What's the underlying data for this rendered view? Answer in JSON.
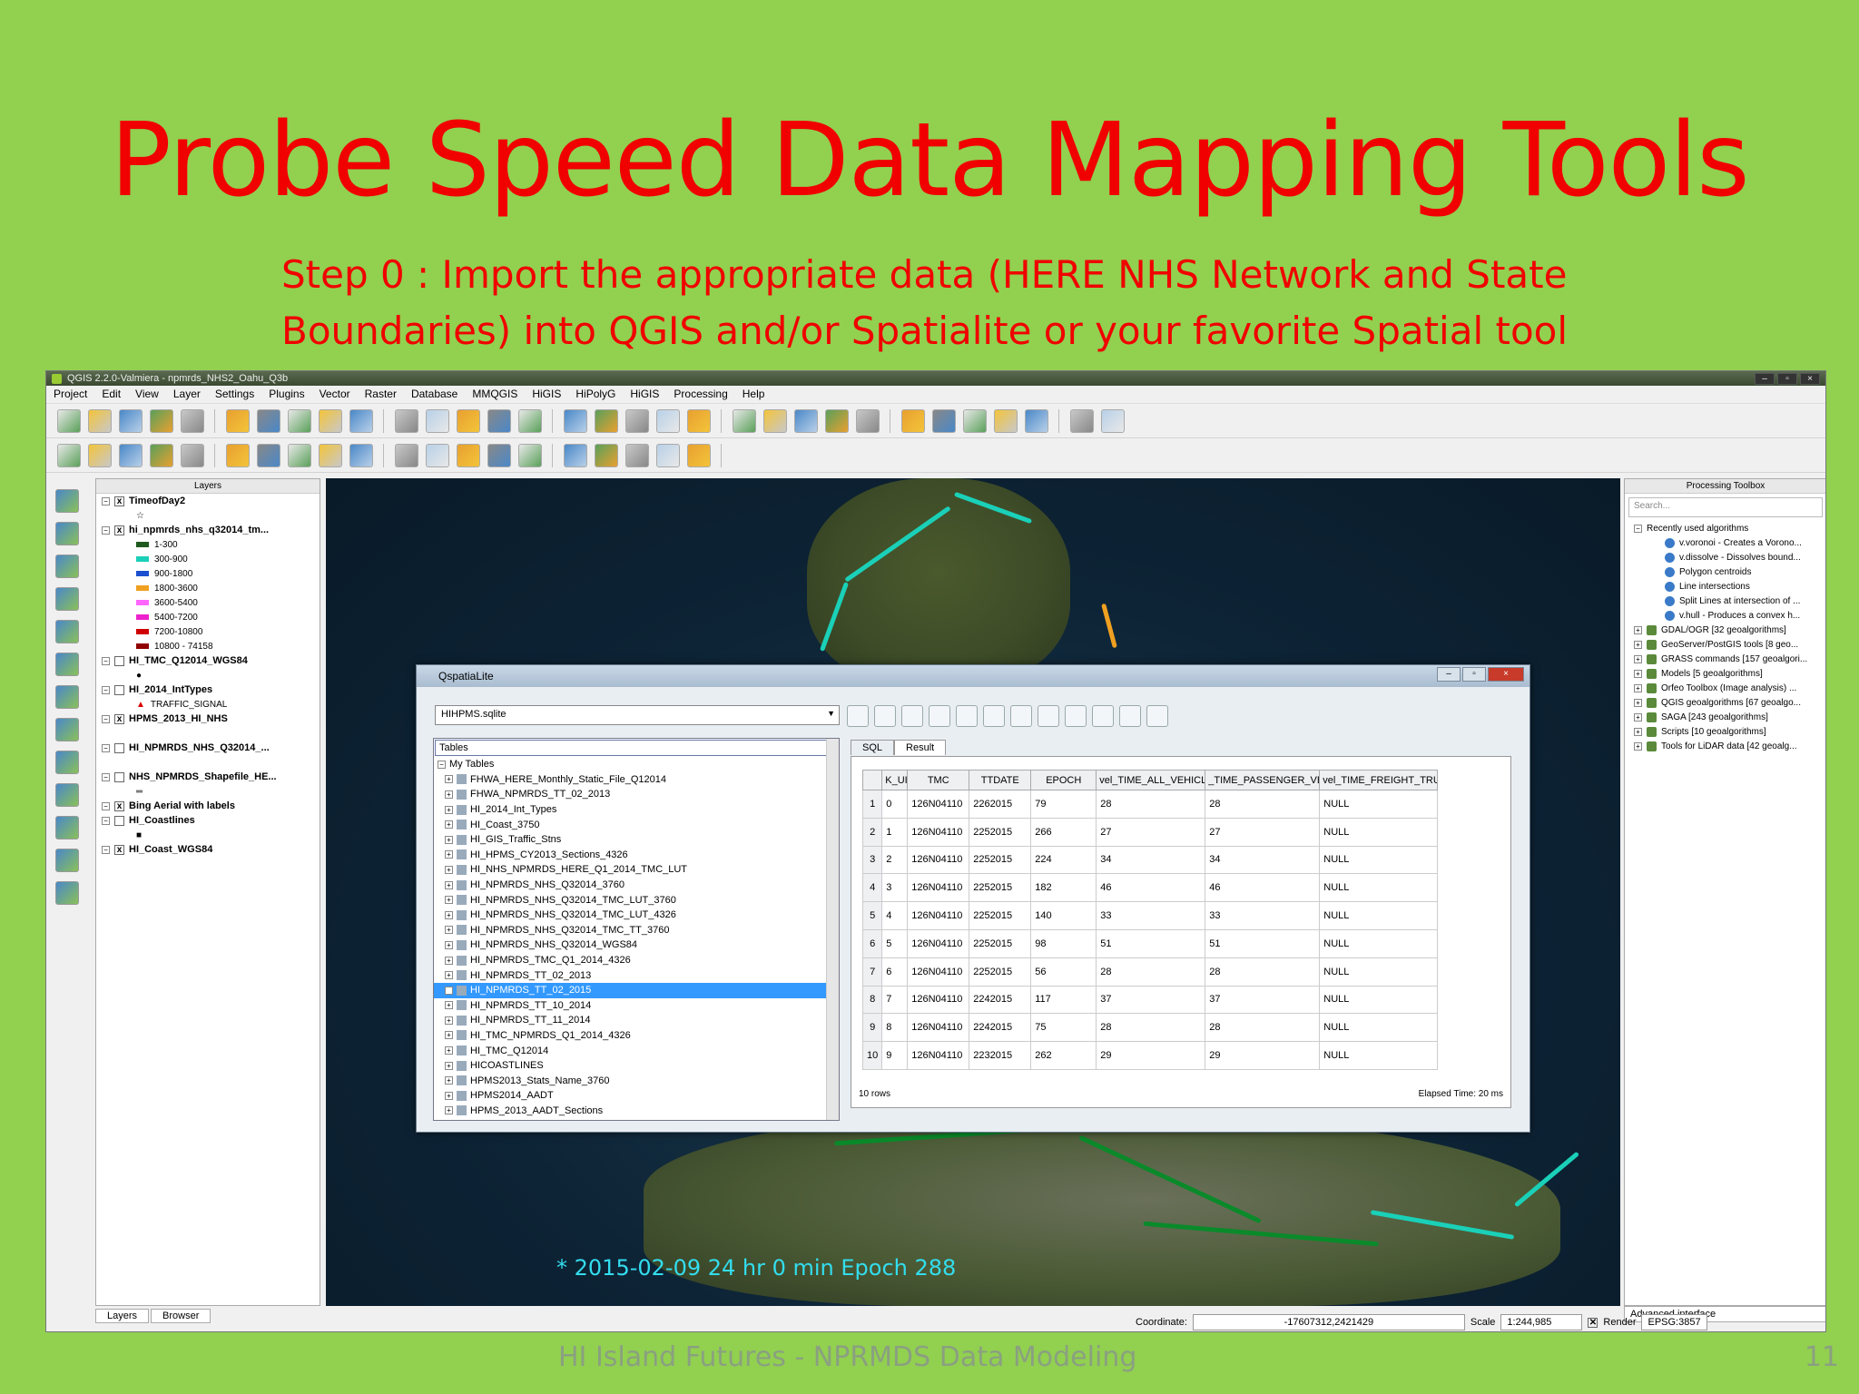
{
  "slide": {
    "title": "Probe Speed Data Mapping Tools",
    "subtitle_line1": "Step 0 : Import the appropriate data (HERE NHS Network and State",
    "subtitle_line2": "Boundaries) into QGIS and/or Spatialite or your favorite Spatial tool",
    "footer": "HI Island Futures - NPRMDS Data Modeling",
    "page_number": "11"
  },
  "window": {
    "title": "QGIS 2.2.0-Valmiera - npmrds_NHS2_Oahu_Q3b",
    "menu": [
      "Project",
      "Edit",
      "View",
      "Layer",
      "Settings",
      "Plugins",
      "Vector",
      "Raster",
      "Database",
      "MMQGIS",
      "HiGIS",
      "HiPolyG",
      "HiGIS",
      "Processing",
      "Help"
    ]
  },
  "layers_panel": {
    "header": "Layers",
    "layers": [
      {
        "name": "TimeofDay2",
        "checked": "x"
      },
      {
        "name": "hi_npmrds_nhs_q32014_tm...",
        "checked": "x"
      },
      {
        "name": "HI_TMC_Q12014_WGS84",
        "checked": ""
      },
      {
        "name": "HI_2014_IntTypes",
        "checked": ""
      },
      {
        "name": "HPMS_2013_HI_NHS",
        "checked": "x"
      },
      {
        "name": "HI_NPMRDS_NHS_Q32014_...",
        "checked": ""
      },
      {
        "name": "NHS_NPMRDS_Shapefile_HE...",
        "checked": ""
      },
      {
        "name": "Bing Aerial with labels",
        "checked": "x"
      },
      {
        "name": "HI_Coastlines",
        "checked": ""
      },
      {
        "name": "HI_Coast_WGS84",
        "checked": "x"
      }
    ],
    "legend": [
      {
        "label": "1-300",
        "color": "#1e5a1e"
      },
      {
        "label": "300-900",
        "color": "#1ad0b8"
      },
      {
        "label": "900-1800",
        "color": "#1a4fd0"
      },
      {
        "label": "1800-3600",
        "color": "#f0a020"
      },
      {
        "label": "3600-5400",
        "color": "#ff66ff"
      },
      {
        "label": "5400-7200",
        "color": "#ee22cc"
      },
      {
        "label": "7200-10800",
        "color": "#d00000"
      },
      {
        "label": "10800 - 74158",
        "color": "#900000"
      }
    ],
    "traffic_signal": "TRAFFIC_SIGNAL",
    "tabs": [
      "Layers",
      "Browser"
    ]
  },
  "map": {
    "timestamp": "* 2015-02-09 24 hr 0 min  Epoch 288"
  },
  "processing": {
    "header": "Processing Toolbox",
    "search_placeholder": "Search...",
    "recent": "Recently used algorithms",
    "recent_items": [
      "v.voronoi - Creates a Vorono...",
      "v.dissolve - Dissolves bound...",
      "Polygon centroids",
      "Line intersections",
      "Split Lines at intersection of ...",
      "v.hull - Produces a convex h..."
    ],
    "groups": [
      "GDAL/OGR [32 geoalgorithms]",
      "GeoServer/PostGIS tools [8 geo...",
      "GRASS commands [157 geoalgori...",
      "Models [5 geoalgorithms]",
      "Orfeo Toolbox (Image analysis) ...",
      "QGIS geoalgorithms [67 geoalgo...",
      "SAGA [243 geoalgorithms]",
      "Scripts [10 geoalgorithms]",
      "Tools for LiDAR data [42 geoalg..."
    ],
    "advanced": "Advanced interface"
  },
  "statusbar": {
    "coordinate_label": "Coordinate:",
    "coordinate": "-17607312,2421429",
    "scale_label": "Scale",
    "scale": "1:244,985",
    "render": "Render",
    "epsg": "EPSG:3857"
  },
  "dialog": {
    "title": "QspatiaLite",
    "db": "HIHPMS.sqlite",
    "tables_header": "Tables",
    "my_tables": "My Tables",
    "tables": [
      "FHWA_HERE_Monthly_Static_File_Q12014",
      "FHWA_NPMRDS_TT_02_2013",
      "HI_2014_Int_Types",
      "HI_Coast_3750",
      "HI_GIS_Traffic_Stns",
      "HI_HPMS_CY2013_Sections_4326",
      "HI_NHS_NPMRDS_HERE_Q1_2014_TMC_LUT",
      "HI_NPMRDS_NHS_Q32014_3760",
      "HI_NPMRDS_NHS_Q32014_TMC_LUT_3760",
      "HI_NPMRDS_NHS_Q32014_TMC_LUT_4326",
      "HI_NPMRDS_NHS_Q32014_TMC_TT_3760",
      "HI_NPMRDS_NHS_Q32014_WGS84",
      "HI_NPMRDS_TMC_Q1_2014_4326",
      "HI_NPMRDS_TT_02_2013",
      "HI_NPMRDS_TT_02_2015",
      "HI_NPMRDS_TT_10_2014",
      "HI_NPMRDS_TT_11_2014",
      "HI_TMC_NPMRDS_Q1_2014_4326",
      "HI_TMC_Q12014",
      "HICOASTLINES",
      "HPMS2013_Stats_Name_3760",
      "HPMS2014_AADT",
      "HPMS_2013_AADT_Sections"
    ],
    "selected_index": 14,
    "tab_sql": "SQL",
    "tab_result": "Result",
    "columns": [
      "K_UI",
      "TMC",
      "TTDATE",
      "EPOCH",
      "vel_TIME_ALL_VEHICL",
      "_TIME_PASSENGER_VEH",
      "vel_TIME_FREIGHT_TRUC"
    ],
    "rows": [
      [
        "1",
        "0",
        "126N04110",
        "2262015",
        "79",
        "28",
        "28",
        "NULL"
      ],
      [
        "2",
        "1",
        "126N04110",
        "2252015",
        "266",
        "27",
        "27",
        "NULL"
      ],
      [
        "3",
        "2",
        "126N04110",
        "2252015",
        "224",
        "34",
        "34",
        "NULL"
      ],
      [
        "4",
        "3",
        "126N04110",
        "2252015",
        "182",
        "46",
        "46",
        "NULL"
      ],
      [
        "5",
        "4",
        "126N04110",
        "2252015",
        "140",
        "33",
        "33",
        "NULL"
      ],
      [
        "6",
        "5",
        "126N04110",
        "2252015",
        "98",
        "51",
        "51",
        "NULL"
      ],
      [
        "7",
        "6",
        "126N04110",
        "2252015",
        "56",
        "28",
        "28",
        "NULL"
      ],
      [
        "8",
        "7",
        "126N04110",
        "2242015",
        "117",
        "37",
        "37",
        "NULL"
      ],
      [
        "9",
        "8",
        "126N04110",
        "2242015",
        "75",
        "28",
        "28",
        "NULL"
      ],
      [
        "10",
        "9",
        "126N04110",
        "2232015",
        "262",
        "29",
        "29",
        "NULL"
      ]
    ],
    "row_count": "10 rows",
    "elapsed": "Elapsed Time: 20 ms"
  }
}
